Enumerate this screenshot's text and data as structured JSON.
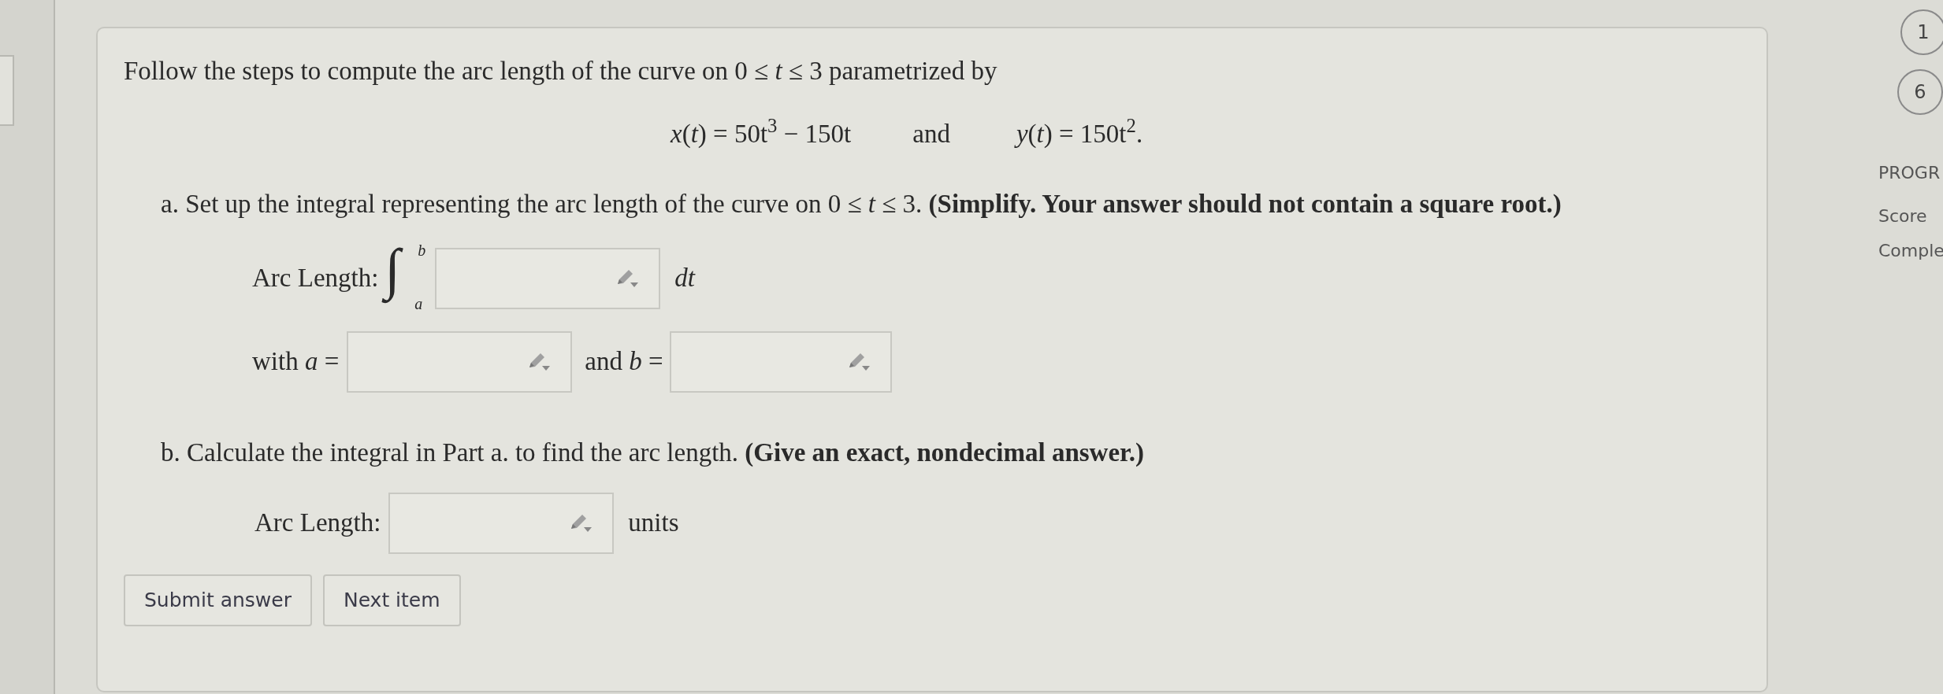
{
  "intro": "Follow the steps to compute the arc length of the curve on 0 ≤ *t* ≤ 3 parametrized by",
  "equation": {
    "x": "*x*(*t*) = 50t$^{3}$ − 150t",
    "joiner": "and",
    "y": "*y*(*t*) = 150t$^{2}$."
  },
  "part_a": {
    "prompt": "a. Set up the integral representing the arc length of the curve on 0 ≤ *t* ≤ 3. **(Simplify. Your answer should not contain a square root.)**",
    "arc_label": "Arc Length:",
    "integral_sign": "∫",
    "upper_limit": "b",
    "lower_limit": "a",
    "differential": "dt",
    "a_label": "with *a* =",
    "b_label": "and *b* ="
  },
  "part_b": {
    "prompt": "b. Calculate the integral in Part a. to find the arc length. **(Give an exact, nondecimal answer.)**",
    "arc_label": "Arc Length:",
    "unit": "units"
  },
  "buttons": [
    "Submit answer",
    "Next item"
  ],
  "sidebar": {
    "question_numbers": [
      "1",
      "6"
    ],
    "progress_heading": "PROGR",
    "score_label": "Score",
    "complete_label": "Comple"
  }
}
